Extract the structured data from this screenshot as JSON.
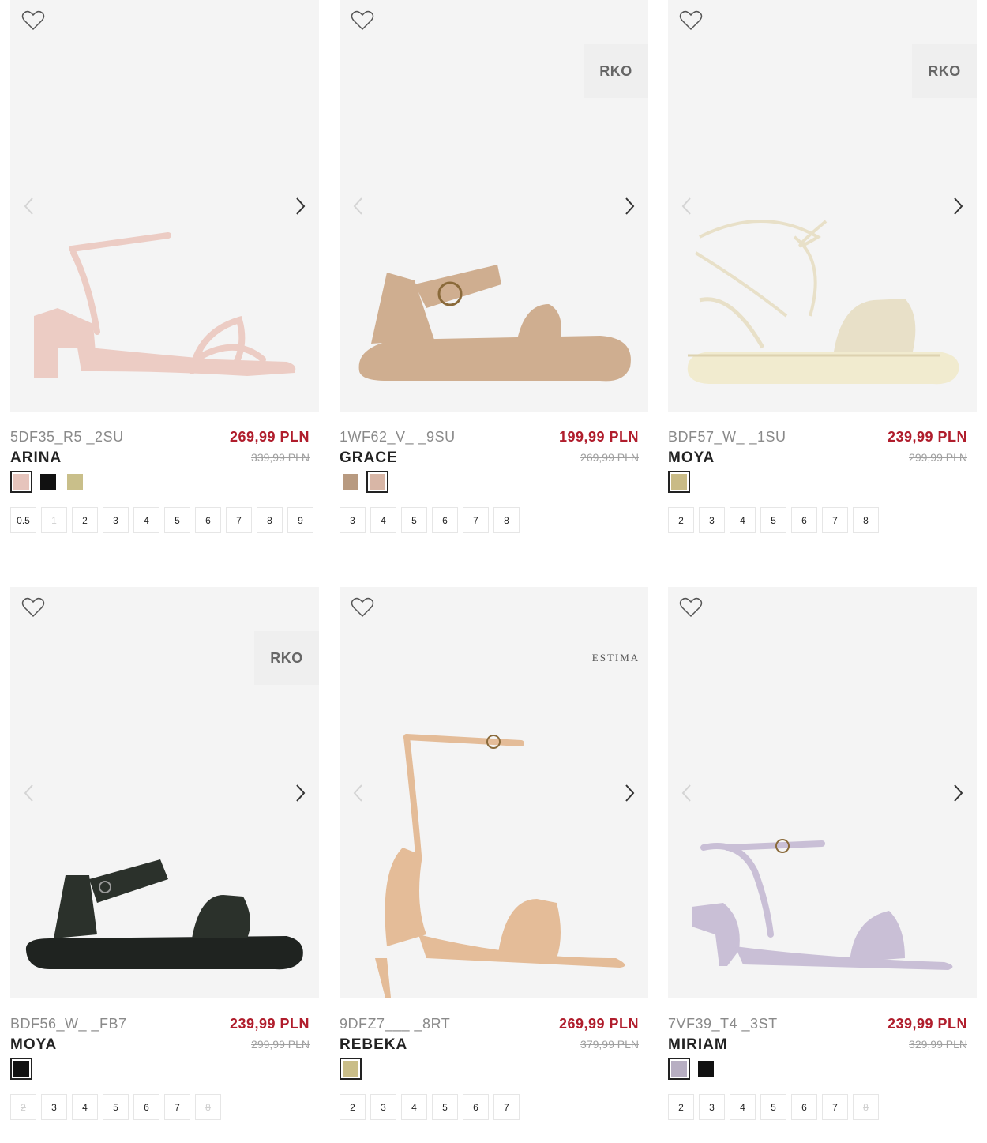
{
  "products": [
    {
      "sku": "5DF35_R5 _2SU",
      "name": "ARINA",
      "price": "269,99 PLN",
      "old_price": "339,99 PLN",
      "brand_badge": "",
      "shoe_color": "#ecccc4",
      "swatches": [
        "#e6c4bc",
        "#111111",
        "#c9bf8a"
      ],
      "selected_swatch": 0,
      "sizes": [
        {
          "label": "0.5",
          "available": true
        },
        {
          "label": "1",
          "available": false
        },
        {
          "label": "2",
          "available": true
        },
        {
          "label": "3",
          "available": true
        },
        {
          "label": "4",
          "available": true
        },
        {
          "label": "5",
          "available": true
        },
        {
          "label": "6",
          "available": true
        },
        {
          "label": "7",
          "available": true
        },
        {
          "label": "8",
          "available": true
        },
        {
          "label": "9",
          "available": true
        }
      ]
    },
    {
      "sku": "1WF62_V_ _9SU",
      "name": "GRACE",
      "price": "199,99 PLN",
      "old_price": "269,99 PLN",
      "brand_badge": "RKO",
      "shoe_color": "#cfae90",
      "swatches": [
        "#b89a80",
        "#d8b6a6"
      ],
      "selected_swatch": 1,
      "sizes": [
        {
          "label": "3",
          "available": true
        },
        {
          "label": "4",
          "available": true
        },
        {
          "label": "5",
          "available": true
        },
        {
          "label": "6",
          "available": true
        },
        {
          "label": "7",
          "available": true
        },
        {
          "label": "8",
          "available": true
        }
      ]
    },
    {
      "sku": "BDF57_W_ _1SU",
      "name": "MOYA",
      "price": "239,99 PLN",
      "old_price": "299,99 PLN",
      "brand_badge": "RKO",
      "shoe_color": "#e8e0c8",
      "swatches": [
        "#c9bb86"
      ],
      "selected_swatch": 0,
      "sizes": [
        {
          "label": "2",
          "available": true
        },
        {
          "label": "3",
          "available": true
        },
        {
          "label": "4",
          "available": true
        },
        {
          "label": "5",
          "available": true
        },
        {
          "label": "6",
          "available": true
        },
        {
          "label": "7",
          "available": true
        },
        {
          "label": "8",
          "available": true
        }
      ]
    },
    {
      "sku": "BDF56_W_ _FB7",
      "name": "MOYA",
      "price": "239,99 PLN",
      "old_price": "299,99 PLN",
      "brand_badge": "RKO",
      "shoe_color": "#1f2320",
      "swatches": [
        "#111111"
      ],
      "selected_swatch": 0,
      "sizes": [
        {
          "label": "2",
          "available": false
        },
        {
          "label": "3",
          "available": true
        },
        {
          "label": "4",
          "available": true
        },
        {
          "label": "5",
          "available": true
        },
        {
          "label": "6",
          "available": true
        },
        {
          "label": "7",
          "available": true
        },
        {
          "label": "8",
          "available": false
        }
      ]
    },
    {
      "sku": "9DFZ7___ _8RT",
      "name": "REBEKA",
      "price": "269,99 PLN",
      "old_price": "379,99 PLN",
      "brand_badge": "ESTIMA",
      "shoe_color": "#e4bc98",
      "swatches": [
        "#c9bd88"
      ],
      "selected_swatch": 0,
      "sizes": [
        {
          "label": "2",
          "available": true
        },
        {
          "label": "3",
          "available": true
        },
        {
          "label": "4",
          "available": true
        },
        {
          "label": "5",
          "available": true
        },
        {
          "label": "6",
          "available": true
        },
        {
          "label": "7",
          "available": true
        }
      ]
    },
    {
      "sku": "7VF39_T4 _3ST",
      "name": "MIRIAM",
      "price": "239,99 PLN",
      "old_price": "329,99 PLN",
      "brand_badge": "",
      "shoe_color": "#c9bfd6",
      "swatches": [
        "#b7aec2",
        "#111111"
      ],
      "selected_swatch": 0,
      "sizes": [
        {
          "label": "2",
          "available": true
        },
        {
          "label": "3",
          "available": true
        },
        {
          "label": "4",
          "available": true
        },
        {
          "label": "5",
          "available": true
        },
        {
          "label": "6",
          "available": true
        },
        {
          "label": "7",
          "available": true
        },
        {
          "label": "8",
          "available": false
        }
      ]
    }
  ],
  "icons": {
    "wishlist": "heart-outline-icon",
    "prev": "chevron-left-icon",
    "next": "chevron-right-icon"
  }
}
